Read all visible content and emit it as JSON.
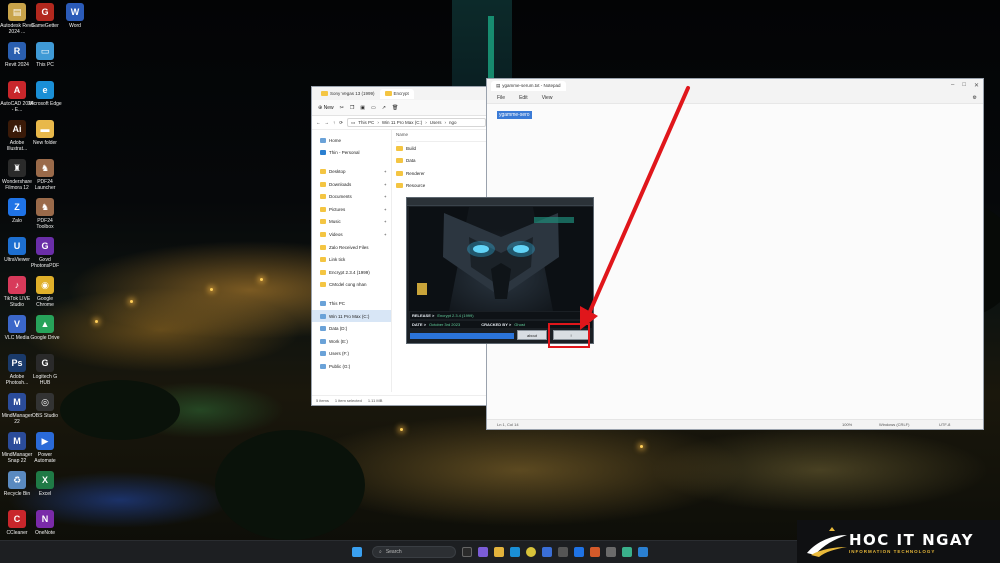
{
  "desktop": {
    "icons": [
      {
        "label": "Autodesk Revit 2024 ...",
        "color": "#c8a34a",
        "glyph": "▤"
      },
      {
        "label": "GameGetter",
        "color": "#b2281e",
        "glyph": "G"
      },
      {
        "label": "Word",
        "color": "#2b5bb8",
        "glyph": "W"
      },
      {
        "label": "Revit 2024",
        "color": "#2a5fb0",
        "glyph": "R"
      },
      {
        "label": "This PC",
        "color": "#3f9ad6",
        "glyph": "▭"
      },
      {
        "label": "AutoCAD 2024 - E...",
        "color": "#c8262b",
        "glyph": "A"
      },
      {
        "label": "Microsoft Edge",
        "color": "#1a8fd6",
        "glyph": "e"
      },
      {
        "label": "Adobe Illustrat...",
        "color": "#3a1a08",
        "glyph": "Ai"
      },
      {
        "label": "New folder",
        "color": "#e8b84a",
        "glyph": "▬"
      },
      {
        "label": "Wondershare Filmora 12",
        "color": "#2a2a2a",
        "glyph": "♜"
      },
      {
        "label": "PDF24 Launcher",
        "color": "#9a6a4a",
        "glyph": "♞"
      },
      {
        "label": "Zalo",
        "color": "#1f73e6",
        "glyph": "Z"
      },
      {
        "label": "PDF24 Toolbox",
        "color": "#9a6a4a",
        "glyph": "♞"
      },
      {
        "label": "UltraViewer",
        "color": "#1d6fd0",
        "glyph": "U"
      },
      {
        "label": "Gxvd PhotonsPDF",
        "color": "#6a2ea8",
        "glyph": "G"
      },
      {
        "label": "TikTok LIVE Studio",
        "color": "#d83a5a",
        "glyph": "♪"
      },
      {
        "label": "Google Chrome",
        "color": "#e0b02a",
        "glyph": "◉"
      },
      {
        "label": "VLC Media",
        "color": "#3b67c9",
        "glyph": "V"
      },
      {
        "label": "Google Drive",
        "color": "#27a35a",
        "glyph": "▲"
      },
      {
        "label": "Adobe Photosh...",
        "color": "#1a3a6a",
        "glyph": "Ps"
      },
      {
        "label": "Logitech G HUB",
        "color": "#2a2a2a",
        "glyph": "G"
      },
      {
        "label": "MindManager 22",
        "color": "#2b4c9a",
        "glyph": "M"
      },
      {
        "label": "OBS Studio",
        "color": "#333",
        "glyph": "◎"
      },
      {
        "label": "MindManager Snap 22",
        "color": "#2b4c9a",
        "glyph": "M"
      },
      {
        "label": "Power Automate",
        "color": "#2a6ad8",
        "glyph": "▶"
      },
      {
        "label": "Recycle Bin",
        "color": "#5a8ac0",
        "glyph": "♻"
      },
      {
        "label": "Excel",
        "color": "#1f7a46",
        "glyph": "X"
      },
      {
        "label": "CCleaner",
        "color": "#c8262b",
        "glyph": "C"
      },
      {
        "label": "OneNote",
        "color": "#7a2aa8",
        "glyph": "N"
      }
    ]
  },
  "explorer": {
    "tabs": [
      "Sony Vegas 13 (1999)",
      "Encrypt"
    ],
    "command_bar": {
      "new": "New",
      "sort": "Sort",
      "view": "View"
    },
    "address": {
      "segments": [
        "This PC",
        "Win 11 Pro Max (C:)",
        "Users",
        "ngo"
      ]
    },
    "nav": [
      {
        "label": "Home",
        "icon": "home-icon"
      },
      {
        "label": "Thin - Personal",
        "icon": "cloud-icon"
      },
      {
        "label": "Desktop",
        "icon": "desktop-icon",
        "pinned": true
      },
      {
        "label": "Downloads",
        "icon": "download-icon",
        "pinned": true
      },
      {
        "label": "Documents",
        "icon": "document-icon",
        "pinned": true
      },
      {
        "label": "Pictures",
        "icon": "picture-icon",
        "pinned": true
      },
      {
        "label": "Music",
        "icon": "music-icon",
        "pinned": true
      },
      {
        "label": "Videos",
        "icon": "video-icon",
        "pinned": true
      },
      {
        "label": "Zalo Received Files",
        "icon": "folder-icon"
      },
      {
        "label": "Link tick",
        "icon": "folder-icon"
      },
      {
        "label": "Encrypt 2.3.4 (1999)",
        "icon": "folder-icon"
      },
      {
        "label": "CMcdel cong nhan",
        "icon": "folder-icon"
      },
      {
        "label": "This PC",
        "icon": "pc-icon"
      },
      {
        "label": "Win 11 Pro Max (C:)",
        "icon": "drive-icon",
        "selected": true
      },
      {
        "label": "Data (D:)",
        "icon": "drive-icon"
      },
      {
        "label": "Work (E:)",
        "icon": "drive-icon"
      },
      {
        "label": "Users (F:)",
        "icon": "drive-icon"
      },
      {
        "label": "Public (G:)",
        "icon": "drive-icon"
      }
    ],
    "column_header": "Name",
    "files": [
      "Build",
      "Data",
      "Renderer",
      "Resource"
    ],
    "status": {
      "count": "5 items",
      "selected": "1 item selected",
      "size": "1.11 MB"
    }
  },
  "notepad": {
    "title": "ygamme-serum.txt - Notepad",
    "menu": [
      "File",
      "Edit",
      "View"
    ],
    "content": "ygamme-sero",
    "status": {
      "position": "Ln 1, Col 14",
      "zoom": "100%",
      "eol": "Windows (CRLF)",
      "encoding": "UTF-8"
    }
  },
  "keygen": {
    "release_label": "RELEASE >",
    "release_value": "Encrypt 2.3.4 (1999)",
    "date_label": "DATE >",
    "date_value": "October 3rd 2023",
    "cracker_label": "CRACKED BY >",
    "cracker_value": "Ghost",
    "about_label": "about",
    "action_label": "!"
  },
  "taskbar": {
    "search_placeholder": "Search"
  },
  "branding": {
    "name": "HOC IT NGAY",
    "tagline": "INFORMATION TECHNOLOGY",
    "accent": "#e9b93a"
  },
  "colors": {
    "highlight": "#e0161b",
    "accent_blue": "#2b74d9"
  }
}
